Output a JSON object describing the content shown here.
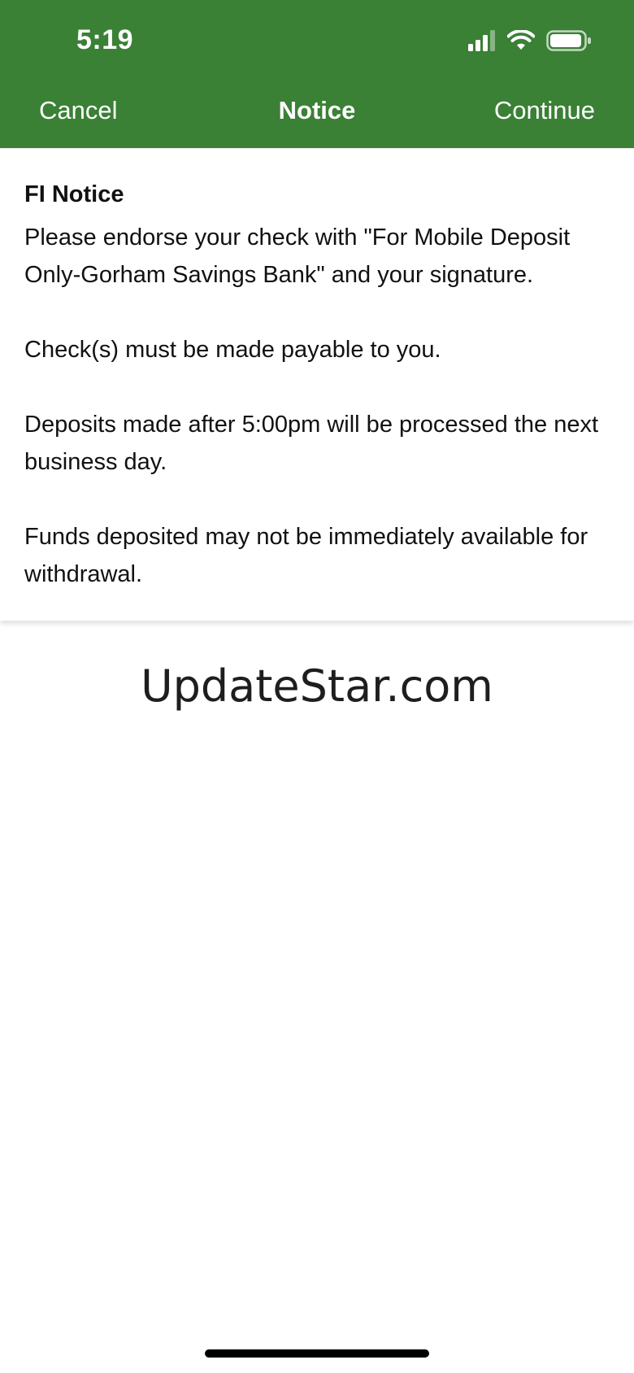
{
  "status_bar": {
    "time": "5:19",
    "icons": [
      "cellular-signal-icon",
      "wifi-icon",
      "battery-icon"
    ]
  },
  "nav": {
    "cancel_label": "Cancel",
    "title": "Notice",
    "continue_label": "Continue"
  },
  "notice": {
    "heading": "FI Notice",
    "paragraphs": [
      "Please endorse your check with \"For Mobile Deposit Only-Gorham Savings Bank\" and your signature.",
      "Check(s) must be made payable to you.",
      "Deposits made after 5:00pm will be processed the next business day.",
      "Funds deposited may not be immediately available for withdrawal."
    ]
  },
  "watermark": "UpdateStar.com",
  "colors": {
    "header_background": "#3a8035",
    "header_text": "#ffffff",
    "body_text": "#111111"
  }
}
